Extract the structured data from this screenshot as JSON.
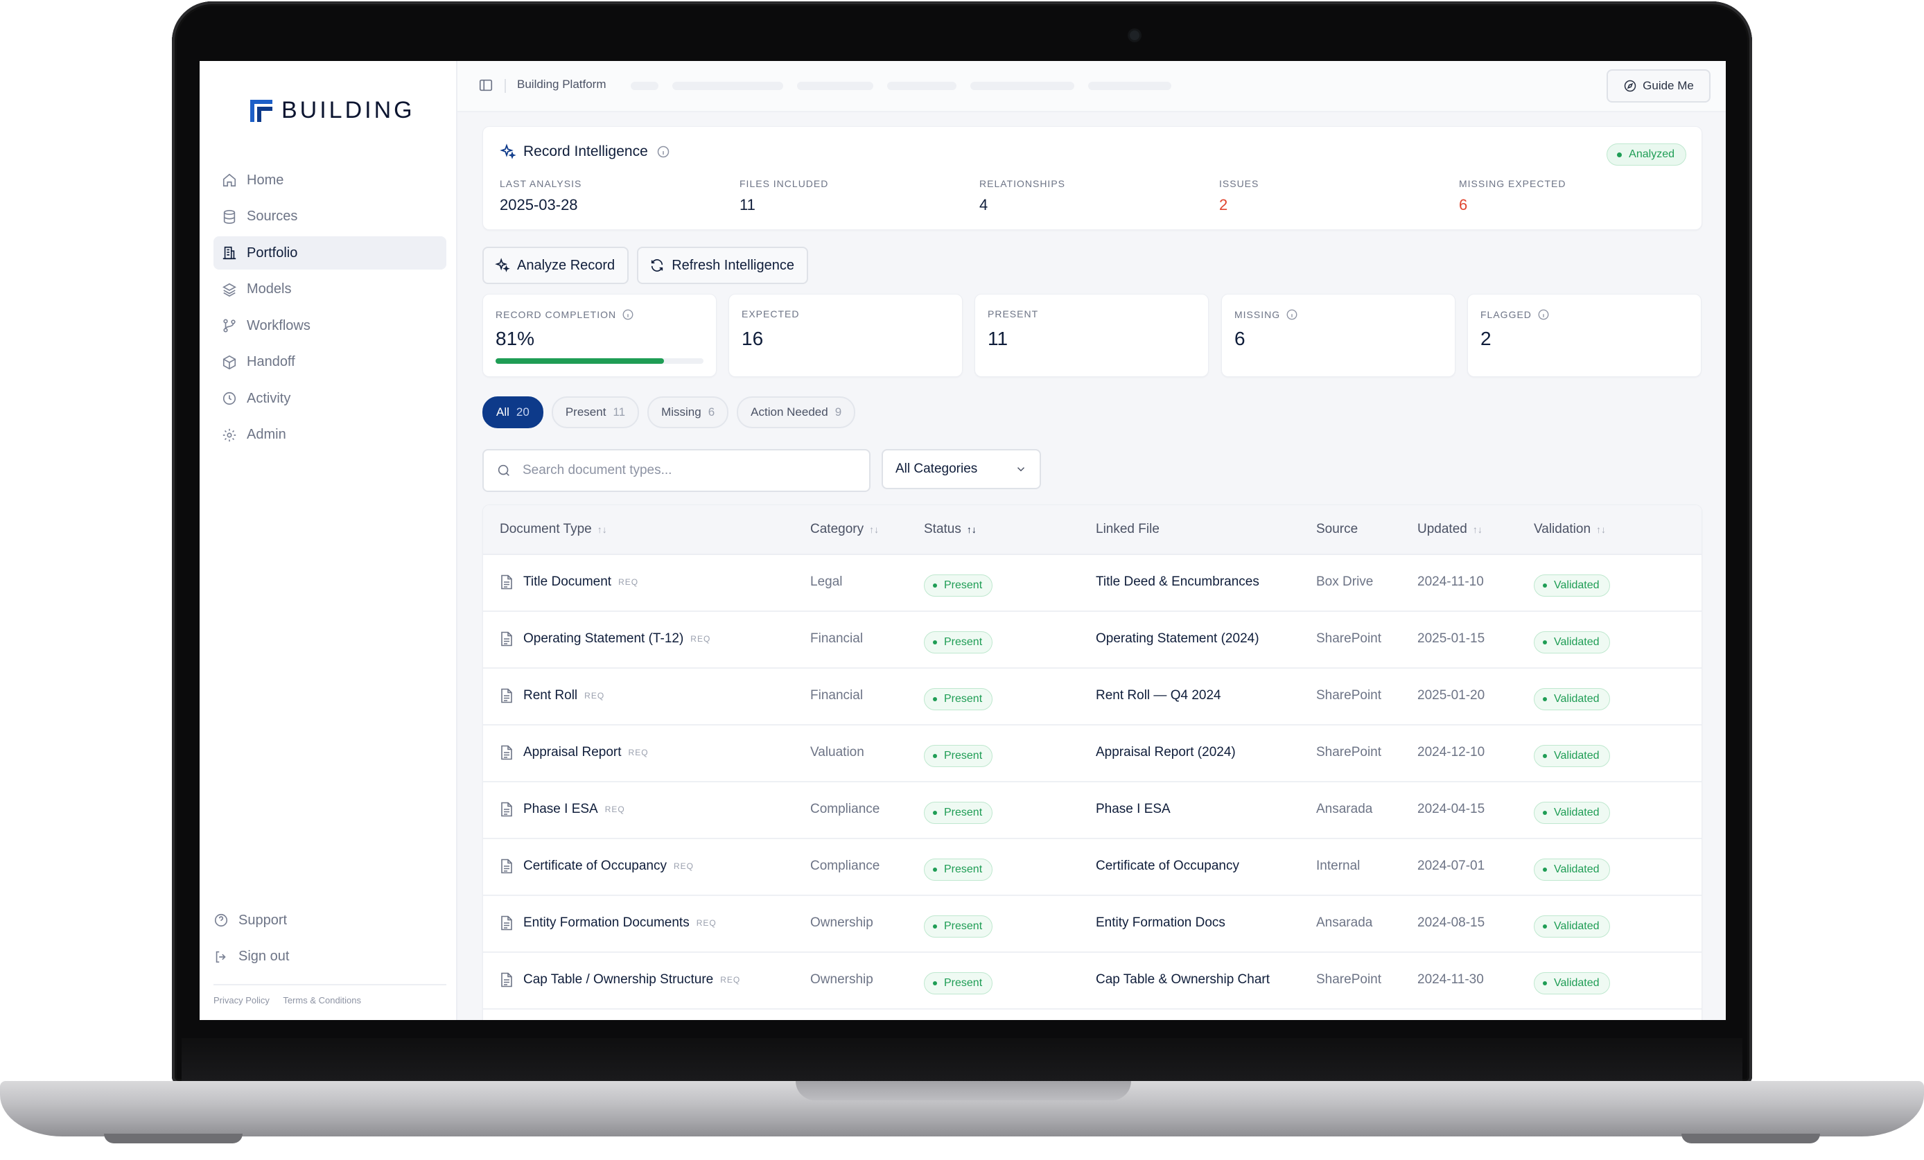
{
  "brand": {
    "name": "BUILDING"
  },
  "sidebar": {
    "items": [
      {
        "label": "Home",
        "icon": "home-icon",
        "active": false
      },
      {
        "label": "Sources",
        "icon": "database-icon",
        "active": false
      },
      {
        "label": "Portfolio",
        "icon": "building-icon",
        "active": true
      },
      {
        "label": "Models",
        "icon": "layers-icon",
        "active": false
      },
      {
        "label": "Workflows",
        "icon": "workflow-icon",
        "active": false
      },
      {
        "label": "Handoff",
        "icon": "package-icon",
        "active": false
      },
      {
        "label": "Activity",
        "icon": "clock-icon",
        "active": false
      },
      {
        "label": "Admin",
        "icon": "gear-icon",
        "active": false
      }
    ],
    "bottom": [
      {
        "label": "Support",
        "icon": "help-circle-icon"
      },
      {
        "label": "Sign out",
        "icon": "log-out-icon"
      }
    ],
    "footer": {
      "privacy": "Privacy Policy",
      "terms": "Terms & Conditions"
    }
  },
  "topbar": {
    "breadcrumb": "Building Platform",
    "guide_label": "Guide Me"
  },
  "record_intelligence": {
    "title": "Record Intelligence",
    "status": "Analyzed",
    "stats": [
      {
        "label": "LAST ANALYSIS",
        "value": "2025-03-28",
        "alert": false
      },
      {
        "label": "FILES INCLUDED",
        "value": "11",
        "alert": false
      },
      {
        "label": "RELATIONSHIPS",
        "value": "4",
        "alert": false
      },
      {
        "label": "ISSUES",
        "value": "2",
        "alert": true
      },
      {
        "label": "MISSING EXPECTED",
        "value": "6",
        "alert": true
      }
    ]
  },
  "actions": {
    "analyze_label": "Analyze Record",
    "refresh_label": "Refresh Intelligence"
  },
  "metrics": {
    "completion": {
      "label": "RECORD COMPLETION",
      "value": "81%",
      "fraction": 0.81
    },
    "expected": {
      "label": "EXPECTED",
      "value": "16"
    },
    "present": {
      "label": "PRESENT",
      "value": "11"
    },
    "missing": {
      "label": "MISSING",
      "value": "6"
    },
    "flagged": {
      "label": "FLAGGED",
      "value": "2"
    }
  },
  "filters": [
    {
      "label": "All",
      "count": "20",
      "active": true
    },
    {
      "label": "Present",
      "count": "11",
      "active": false
    },
    {
      "label": "Missing",
      "count": "6",
      "active": false
    },
    {
      "label": "Action Needed",
      "count": "9",
      "active": false
    }
  ],
  "search": {
    "placeholder": "Search document types...",
    "value": ""
  },
  "category_select": {
    "selected": "All Categories"
  },
  "table": {
    "columns": {
      "document_type": "Document Type",
      "category": "Category",
      "status": "Status",
      "linked_file": "Linked File",
      "source": "Source",
      "updated": "Updated",
      "validation": "Validation"
    },
    "req_tag": "REQ",
    "rows": [
      {
        "doc": "Title Document",
        "category": "Legal",
        "status": "Present",
        "file": "Title Deed & Encumbrances",
        "source": "Box Drive",
        "updated": "2024-11-10",
        "validation": "Validated"
      },
      {
        "doc": "Operating Statement (T-12)",
        "category": "Financial",
        "status": "Present",
        "file": "Operating Statement (2024)",
        "source": "SharePoint",
        "updated": "2025-01-15",
        "validation": "Validated"
      },
      {
        "doc": "Rent Roll",
        "category": "Financial",
        "status": "Present",
        "file": "Rent Roll — Q4 2024",
        "source": "SharePoint",
        "updated": "2025-01-20",
        "validation": "Validated"
      },
      {
        "doc": "Appraisal Report",
        "category": "Valuation",
        "status": "Present",
        "file": "Appraisal Report (2024)",
        "source": "SharePoint",
        "updated": "2024-12-10",
        "validation": "Validated"
      },
      {
        "doc": "Phase I ESA",
        "category": "Compliance",
        "status": "Present",
        "file": "Phase I ESA",
        "source": "Ansarada",
        "updated": "2024-04-15",
        "validation": "Validated"
      },
      {
        "doc": "Certificate of Occupancy",
        "category": "Compliance",
        "status": "Present",
        "file": "Certificate of Occupancy",
        "source": "Internal",
        "updated": "2024-07-01",
        "validation": "Validated"
      },
      {
        "doc": "Entity Formation Documents",
        "category": "Ownership",
        "status": "Present",
        "file": "Entity Formation Docs",
        "source": "Ansarada",
        "updated": "2024-08-15",
        "validation": "Validated"
      },
      {
        "doc": "Cap Table / Ownership Structure",
        "category": "Ownership",
        "status": "Present",
        "file": "Cap Table & Ownership Chart",
        "source": "SharePoint",
        "updated": "2024-11-30",
        "validation": "Validated"
      }
    ]
  },
  "colors": {
    "accent": "#0d3a8a",
    "success": "#1f9d55",
    "alert": "#e0452f"
  }
}
